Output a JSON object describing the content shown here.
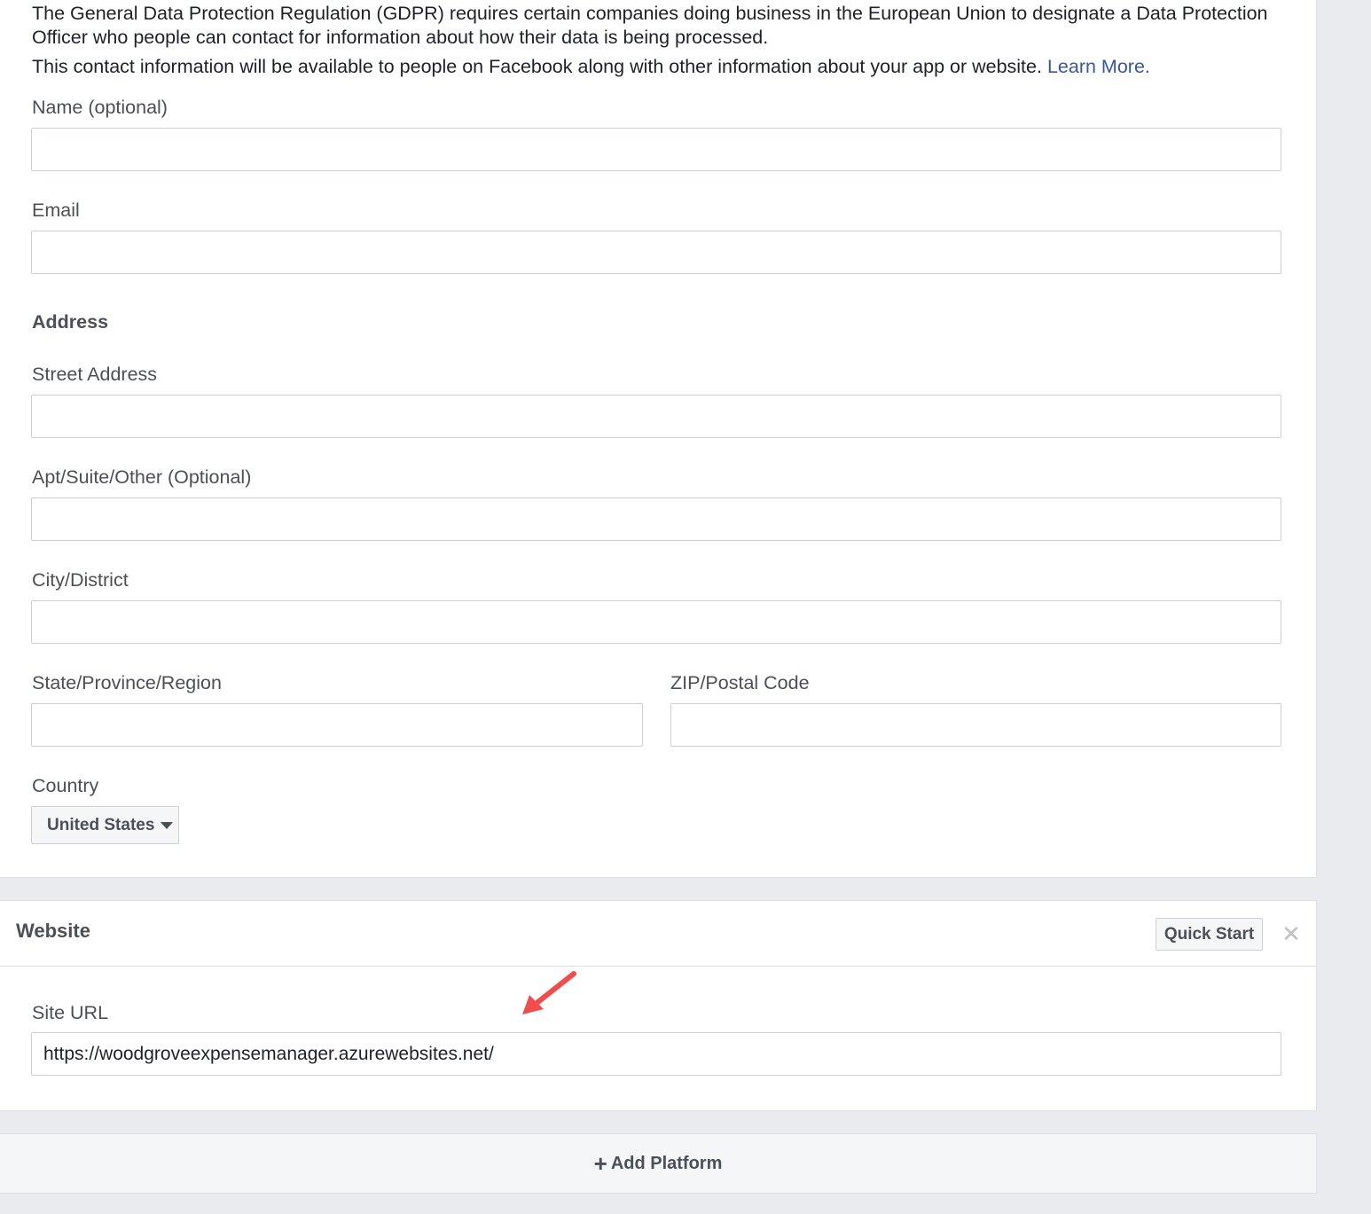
{
  "gdpr": {
    "description_line1": "The General Data Protection Regulation (GDPR) requires certain companies doing business in the European Union to designate a Data Protection Officer who people can contact for information about how their data is being processed.",
    "description_line2": "This contact information will be available to people on Facebook along with other information about your app or website.",
    "learn_more": "Learn More.",
    "name_label": "Name (optional)",
    "name_value": "",
    "email_label": "Email",
    "email_value": "",
    "address_heading": "Address",
    "street_label": "Street Address",
    "street_value": "",
    "apt_label": "Apt/Suite/Other (Optional)",
    "apt_value": "",
    "city_label": "City/District",
    "city_value": "",
    "state_label": "State/Province/Region",
    "state_value": "",
    "zip_label": "ZIP/Postal Code",
    "zip_value": "",
    "country_label": "Country",
    "country_selected": "United States"
  },
  "website": {
    "title": "Website",
    "quick_start_label": "Quick Start",
    "close_icon": "close-icon",
    "site_url_label": "Site URL",
    "site_url_value": "https://woodgroveexpensemanager.azurewebsites.net/",
    "annotation_arrow_color": "#f04e4e"
  },
  "footer": {
    "add_platform_label": "Add Platform",
    "plus_icon": "plus-icon"
  }
}
